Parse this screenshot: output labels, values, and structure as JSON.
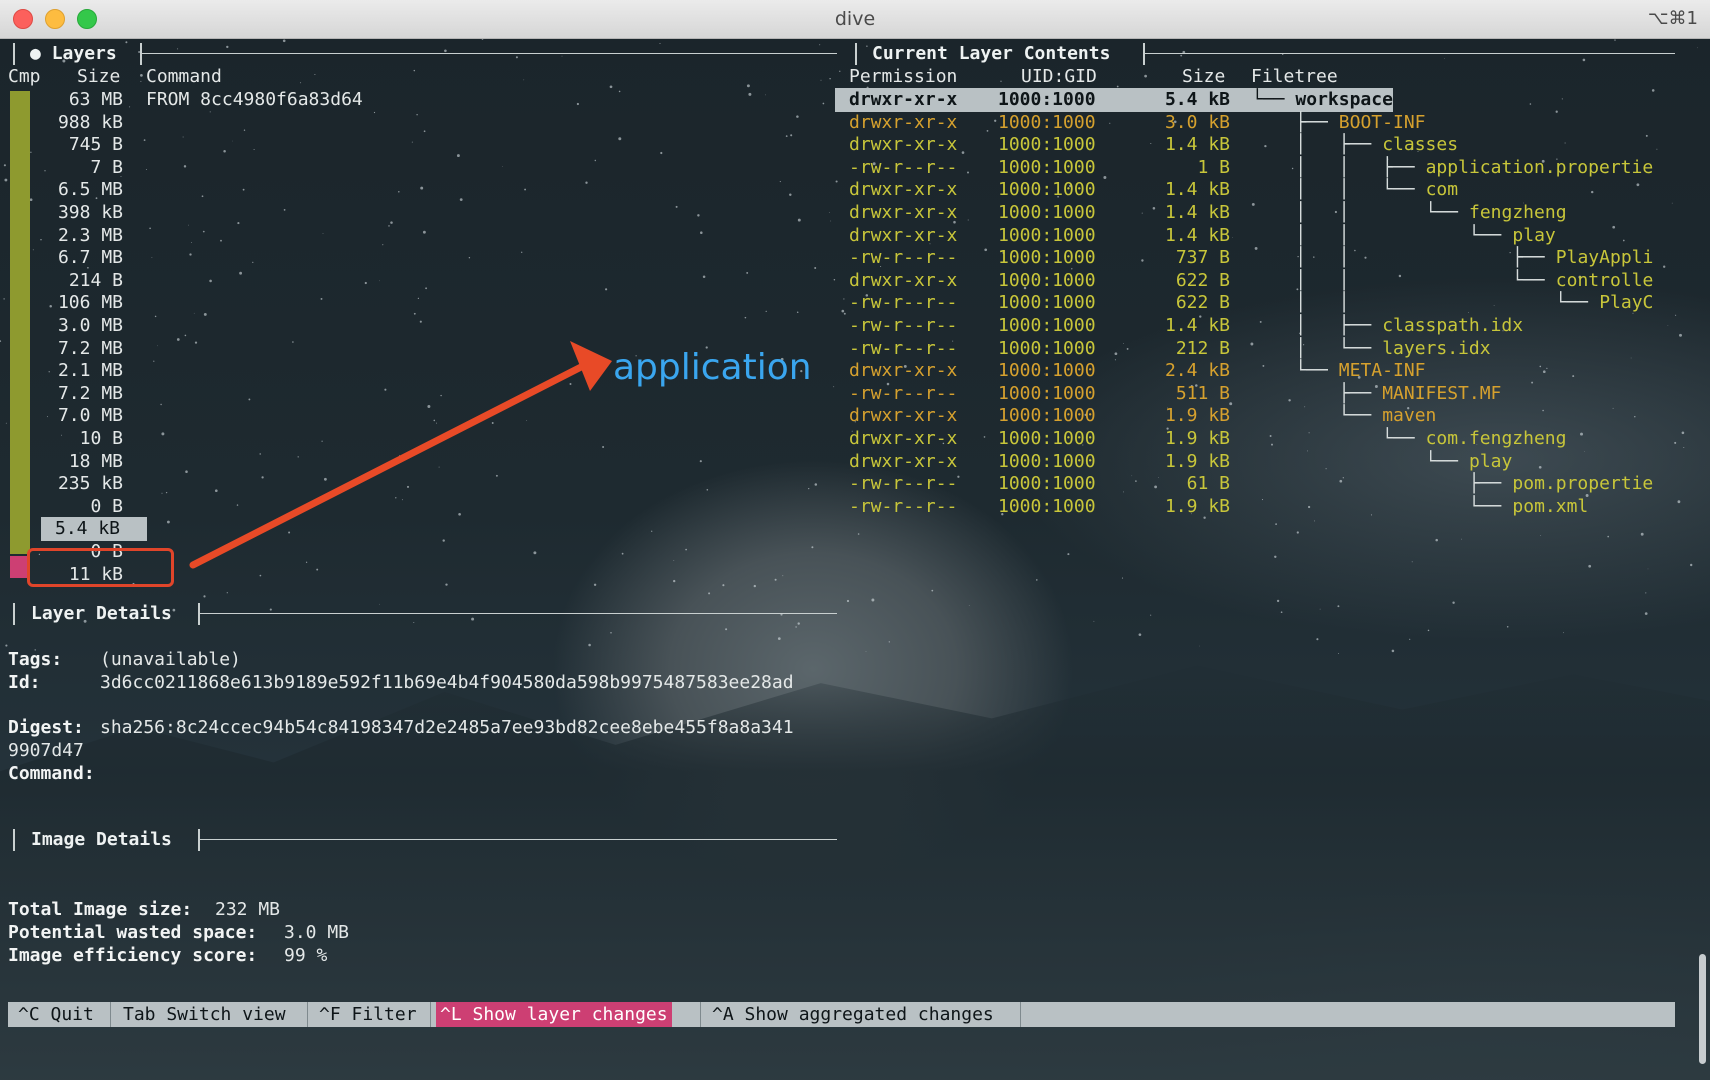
{
  "window": {
    "title": "dive",
    "shortcut": "⌥⌘1"
  },
  "layers_panel": {
    "title": "Layers",
    "columns": {
      "cmp": "Cmp",
      "size": "Size",
      "command": "Command"
    },
    "first_command": "FROM 8cc4980f6a83d64",
    "sizes": [
      "63 MB",
      "988 kB",
      "745 B",
      "7 B",
      "6.5 MB",
      "398 kB",
      "2.3 MB",
      "6.7 MB",
      "214 B",
      "106 MB",
      "3.0 MB",
      "7.2 MB",
      "2.1 MB",
      "7.2 MB",
      "7.0 MB",
      "10 B",
      "18 MB",
      "235 kB",
      "0 B",
      "5.4 kB",
      "0 B",
      "11 kB"
    ],
    "selected_index": 19,
    "cmp_colors": {
      "unchanged": "#8e9a2f",
      "modified": "#cd3f73"
    }
  },
  "contents_panel": {
    "title": "Current Layer Contents",
    "columns": {
      "permission": "Permission",
      "uid_gid": "UID:GID",
      "size": "Size",
      "filetree": "Filetree"
    },
    "rows": [
      {
        "perm": "drwxr-xr-x",
        "uid": "1000:1000",
        "size": "5.4 kB",
        "prefix": "└── ",
        "name": "workspace",
        "color": "sel"
      },
      {
        "perm": "drwxr-xr-x",
        "uid": "1000:1000",
        "size": "3.0 kB",
        "prefix": "    ├── ",
        "name": "BOOT-INF",
        "color": "orange"
      },
      {
        "perm": "drwxr-xr-x",
        "uid": "1000:1000",
        "size": "1.4 kB",
        "prefix": "    │   ├── ",
        "name": "classes",
        "color": "yellow"
      },
      {
        "perm": "-rw-r--r--",
        "uid": "1000:1000",
        "size": "1 B",
        "prefix": "    │   │   ├── ",
        "name": "application.propertie",
        "color": "yellow"
      },
      {
        "perm": "drwxr-xr-x",
        "uid": "1000:1000",
        "size": "1.4 kB",
        "prefix": "    │   │   └── ",
        "name": "com",
        "color": "yellow"
      },
      {
        "perm": "drwxr-xr-x",
        "uid": "1000:1000",
        "size": "1.4 kB",
        "prefix": "    │   │       └── ",
        "name": "fengzheng",
        "color": "yellow"
      },
      {
        "perm": "drwxr-xr-x",
        "uid": "1000:1000",
        "size": "1.4 kB",
        "prefix": "    │   │           └── ",
        "name": "play",
        "color": "yellow"
      },
      {
        "perm": "-rw-r--r--",
        "uid": "1000:1000",
        "size": "737 B",
        "prefix": "    │   │               ├── ",
        "name": "PlayAppli",
        "color": "yellow"
      },
      {
        "perm": "drwxr-xr-x",
        "uid": "1000:1000",
        "size": "622 B",
        "prefix": "    │   │               └── ",
        "name": "controlle",
        "color": "yellow"
      },
      {
        "perm": "-rw-r--r--",
        "uid": "1000:1000",
        "size": "622 B",
        "prefix": "    │   │                   └── ",
        "name": "PlayC",
        "color": "yellow"
      },
      {
        "perm": "-rw-r--r--",
        "uid": "1000:1000",
        "size": "1.4 kB",
        "prefix": "    │   ├── ",
        "name": "classpath.idx",
        "color": "yellow"
      },
      {
        "perm": "-rw-r--r--",
        "uid": "1000:1000",
        "size": "212 B",
        "prefix": "    │   └── ",
        "name": "layers.idx",
        "color": "yellow"
      },
      {
        "perm": "drwxr-xr-x",
        "uid": "1000:1000",
        "size": "2.4 kB",
        "prefix": "    └── ",
        "name": "META-INF",
        "color": "orange"
      },
      {
        "perm": "-rw-r--r--",
        "uid": "1000:1000",
        "size": "511 B",
        "prefix": "        ├── ",
        "name": "MANIFEST.MF",
        "color": "orange"
      },
      {
        "perm": "drwxr-xr-x",
        "uid": "1000:1000",
        "size": "1.9 kB",
        "prefix": "        └── ",
        "name": "maven",
        "color": "orange"
      },
      {
        "perm": "drwxr-xr-x",
        "uid": "1000:1000",
        "size": "1.9 kB",
        "prefix": "            └── ",
        "name": "com.fengzheng",
        "color": "yellow"
      },
      {
        "perm": "drwxr-xr-x",
        "uid": "1000:1000",
        "size": "1.9 kB",
        "prefix": "                └── ",
        "name": "play",
        "color": "yellow"
      },
      {
        "perm": "-rw-r--r--",
        "uid": "1000:1000",
        "size": "61 B",
        "prefix": "                    ├── ",
        "name": "pom.propertie",
        "color": "yellow"
      },
      {
        "perm": "-rw-r--r--",
        "uid": "1000:1000",
        "size": "1.9 kB",
        "prefix": "                    └── ",
        "name": "pom.xml",
        "color": "yellow"
      }
    ]
  },
  "layer_details": {
    "title": "Layer Details",
    "tags_label": "Tags:",
    "tags_value": "(unavailable)",
    "id_label": "Id:",
    "id_value": "3d6cc0211868e613b9189e592f11b69e4b4f904580da598b9975487583ee28ad",
    "digest_label": "Digest:",
    "digest_value": "sha256:8c24ccec94b54c84198347d2e2485a7ee93bd82cee8ebe455f8a8a341",
    "digest_cont": "9907d47",
    "command_label": "Command:"
  },
  "image_details": {
    "title": "Image Details",
    "total_label": "Total Image size:",
    "total_value": "232 MB",
    "wasted_label": "Potential wasted space:",
    "wasted_value": "3.0 MB",
    "efficiency_label": "Image efficiency score:",
    "efficiency_value": "99 %"
  },
  "footer": {
    "quit": "^C Quit",
    "switch": "Tab Switch view",
    "filter": "^F Filter",
    "layer_changes": "^L Show layer changes",
    "aggregated": "^A Show aggregated changes"
  },
  "annotation": {
    "text": "application",
    "arrow_color": "#e84a27",
    "text_color": "#3aa6ef"
  },
  "colors": {
    "yellow": "#c8c63a",
    "orange": "#d6a12e",
    "selection": "#b9c1c4",
    "active_key": "#cd3f73"
  }
}
